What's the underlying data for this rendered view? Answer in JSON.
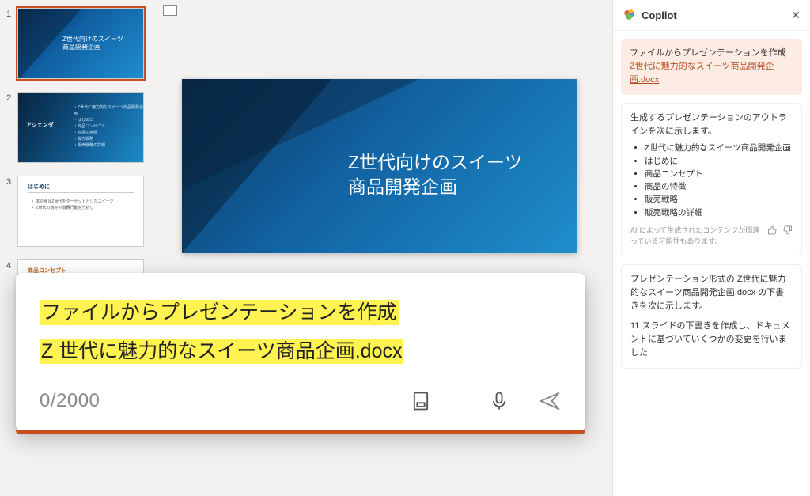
{
  "thumbs": {
    "s1_title": "Z世代向けのスイーツ\n商品開発企画",
    "s2_left": "アジェンダ",
    "s2_items": "・Z世代に魅力的なスイーツ商品開発企画\n・はじめに\n・商品コンセプト\n・商品の特徴\n・販売戦略\n・販売戦略の詳細",
    "s3_head": "はじめに",
    "s3_txt": "・ 本企画はZ世代をターゲットとしたスイーツ\n・ Z世代の嗜好や消費行動を分析し",
    "s4_head": "商品コンセプト"
  },
  "slide": {
    "title_l1": "Z世代向けのスイーツ",
    "title_l2": "商品開発企画"
  },
  "copilot": {
    "brand": "Copilot",
    "promptCard": {
      "prefix": "ファイルからプレゼンテーションを作成 ",
      "link": "Z世代に魅力的なスイーツ商品開発企画.docx"
    },
    "outlineCard": {
      "intro": "生成するプレゼンテーションのアウトラインを次に示します。",
      "items": [
        "Z世代に魅力的なスイーツ商品開発企画",
        "はじめに",
        "商品コンセプト",
        "商品の特徴",
        "販売戦略",
        "販売戦略の詳細"
      ],
      "disclaimer": "AI によって生成されたコンテンツが間違っている可能性もあります。"
    },
    "draftCard": {
      "p1": "プレゼンテーション形式の Z世代に魅力的なスイーツ商品開発企画.docx の下書きを次に示します。",
      "p2": "11 スライドの下書きを作成し、ドキュメントに基づいていくつかの変更を行いました:"
    }
  },
  "overlay": {
    "line1": "ファイルからプレゼンテーションを作成",
    "line2": "Z 世代に魅力的なスイーツ商品企画.docx",
    "counter": "0/2000"
  }
}
